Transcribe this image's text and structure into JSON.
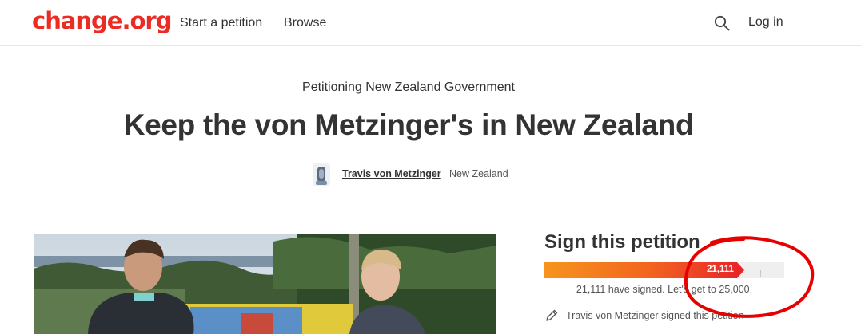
{
  "header": {
    "logo": "change.org",
    "nav": {
      "start_petition": "Start a petition",
      "browse": "Browse"
    },
    "login": "Log in",
    "search_icon": "search-icon"
  },
  "petition": {
    "petitioning_prefix": "Petitioning ",
    "target": "New Zealand Government",
    "title": "Keep the von Metzinger's in New Zealand",
    "author": "Travis von Metzinger",
    "location": "New Zealand"
  },
  "sign": {
    "title": "Sign this petition",
    "count_label": "21,111",
    "signatures": 21111,
    "goal": 25000,
    "signed_text": "21,111 have signed. Let's get to 25,000.",
    "recent": "Travis von Metzinger signed this petition"
  },
  "colors": {
    "brand": "#ec2c22",
    "progress_start": "#f7941d",
    "progress_end": "#e8262a",
    "annotation": "#e60000"
  }
}
